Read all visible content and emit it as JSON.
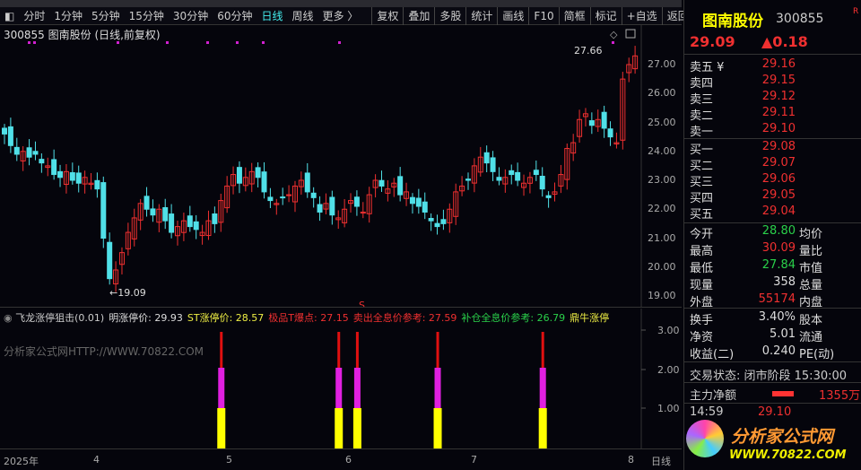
{
  "toolbar": {
    "periods": [
      "分时",
      "1分钟",
      "5分钟",
      "15分钟",
      "30分钟",
      "60分钟",
      "日线",
      "周线",
      "更多 〉"
    ],
    "active": "日线",
    "buttons": [
      "复权",
      "叠加",
      "多股",
      "统计",
      "画线",
      "F10",
      "简框",
      "标记",
      "+自选",
      "返回"
    ]
  },
  "chart_title": "300855 图南股份 (日线,前复权)",
  "price_axis": [
    "27.00",
    "26.00",
    "25.00",
    "24.00",
    "23.00",
    "22.00",
    "21.00",
    "20.00",
    "19.00"
  ],
  "annotations": {
    "high": "27.66",
    "low": "19.09",
    "signal": "S"
  },
  "chart_data": {
    "type": "candlestick",
    "closes": [
      24.6,
      24.2,
      23.9,
      24.0,
      23.8,
      23.9,
      23.6,
      23.5,
      23.2,
      23.1,
      23.3,
      23.0,
      22.9,
      23.1,
      22.9,
      22.7,
      21.0,
      19.6,
      19.9,
      20.5,
      21.2,
      21.7,
      22.2,
      22.0,
      21.8,
      22.0,
      21.6,
      21.2,
      21.4,
      21.6,
      21.4,
      21.3,
      21.2,
      21.6,
      21.5,
      22.3,
      22.8,
      23.2,
      22.9,
      23.1,
      23.3,
      23.1,
      22.6,
      22.3,
      22.2,
      22.4,
      22.5,
      22.8,
      23.0,
      22.6,
      22.4,
      21.9,
      22.2,
      21.8,
      21.7,
      22.0,
      22.3,
      22.1,
      21.9,
      22.5,
      23.0,
      22.8,
      22.7,
      22.9,
      22.5,
      22.6,
      22.2,
      22.1,
      21.9,
      21.6,
      21.4,
      21.5,
      22.0,
      22.6,
      22.8,
      23.0,
      23.5,
      23.8,
      23.6,
      23.3,
      23.0,
      23.1,
      23.2,
      23.0,
      22.9,
      23.1,
      23.2,
      22.7,
      22.4,
      22.6,
      23.2,
      24.1,
      24.3,
      25.1,
      25.3,
      24.9,
      25.1,
      24.8,
      24.5,
      24.3,
      26.5,
      27.0,
      27.3
    ],
    "ylim": [
      18.7,
      27.9
    ],
    "signal_days": [
      35,
      54,
      57,
      70,
      87
    ]
  },
  "indicator": {
    "name": "飞龙涨停狙击(0.01)",
    "fields": [
      {
        "label": "明涨停价: 29.93",
        "color": "#dddddd"
      },
      {
        "label": "ST涨停价: 28.57",
        "color": "#eeee44"
      },
      {
        "label": "极品T爆点: 27.15",
        "color": "#f03030"
      },
      {
        "label": "卖出全息价参考: 27.59",
        "color": "#f03030"
      },
      {
        "label": "补仓全息价参考: 26.79",
        "color": "#2ad04a"
      },
      {
        "label": "鼎牛涨停",
        "color": "#eeee44"
      }
    ],
    "axis": [
      "3.00",
      "2.00",
      "1.00"
    ],
    "watermark": "分析家公式网HTTP://WWW.70822.COM"
  },
  "xaxis": {
    "labels": [
      "2025年",
      "4",
      "5",
      "6",
      "7",
      "8"
    ],
    "period": "日线"
  },
  "quote": {
    "name": "图南股份",
    "code": "300855",
    "tag": "R",
    "price": "29.09",
    "change": "▲0.18",
    "asks": [
      {
        "l": "卖五 ¥",
        "v": "29.16"
      },
      {
        "l": "卖四",
        "v": "29.15"
      },
      {
        "l": "卖三",
        "v": "29.12"
      },
      {
        "l": "卖二",
        "v": "29.11"
      },
      {
        "l": "卖一",
        "v": "29.10"
      }
    ],
    "bids": [
      {
        "l": "买一",
        "v": "29.08"
      },
      {
        "l": "买二",
        "v": "29.07"
      },
      {
        "l": "买三",
        "v": "29.06"
      },
      {
        "l": "买四",
        "v": "29.05"
      },
      {
        "l": "买五",
        "v": "29.04"
      }
    ],
    "stats": [
      {
        "l": "今开",
        "v": "28.80",
        "c": "green",
        "l2": "均价"
      },
      {
        "l": "最高",
        "v": "30.09",
        "c": "red",
        "l2": "量比"
      },
      {
        "l": "最低",
        "v": "27.84",
        "c": "green",
        "l2": "市值"
      },
      {
        "l": "现量",
        "v": "358",
        "c": "white",
        "l2": "总量"
      },
      {
        "l": "外盘",
        "v": "55174",
        "c": "red",
        "l2": "内盘"
      }
    ],
    "fin": [
      {
        "l": "换手",
        "v": "3.40%",
        "l2": "股本"
      },
      {
        "l": "净资",
        "v": "5.01",
        "l2": "流通"
      },
      {
        "l": "收益(二)",
        "v": "0.240",
        "l2": "PE(动)"
      }
    ],
    "status": "交易状态: 闭市阶段 15:30:00",
    "mainflow_label": "主力净额",
    "mainflow_value": "1355万",
    "tick_time": "14:59",
    "tick_price": "29.10",
    "logo_text": "分析家公式网",
    "logo_url": "WWW.70822.COM"
  }
}
